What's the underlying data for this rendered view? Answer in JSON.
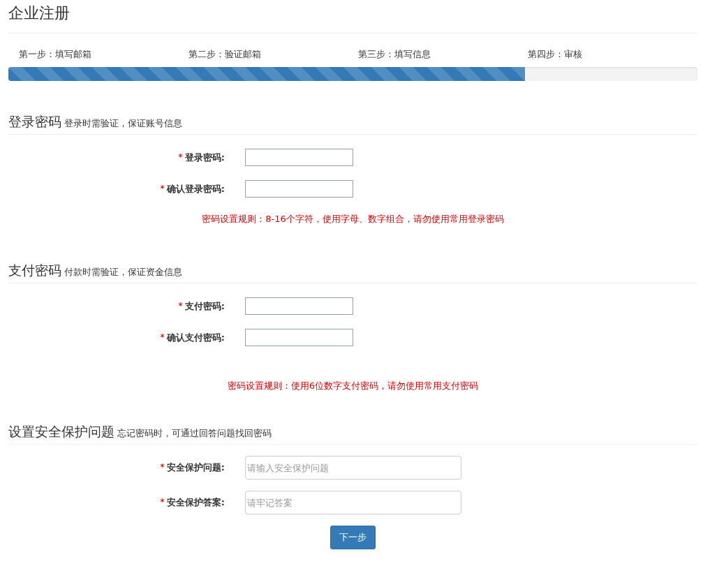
{
  "title": "企业注册",
  "steps": [
    {
      "label": "第一步：填写邮箱"
    },
    {
      "label": "第二步：验证邮箱"
    },
    {
      "label": "第三步：填写信息"
    },
    {
      "label": "第四步：审核"
    }
  ],
  "progress": {
    "level": 0.75
  },
  "sections": [
    {
      "title": "登录密码",
      "subtitle": "登录时需验证，保证账号信息",
      "fields": [
        {
          "kind": "password",
          "required_mark": "*",
          "label": "登录密码:"
        },
        {
          "kind": "password",
          "required_mark": "*",
          "label": "确认登录密码:"
        }
      ],
      "note": "密码设置规则：8-16个字符，使用字母、数字组合，请勿使用常用登录密码"
    },
    {
      "title": "支付密码",
      "subtitle": "付款时需验证，保证资金信息",
      "fields": [
        {
          "kind": "password",
          "required_mark": "*",
          "label": "支付密码:"
        },
        {
          "kind": "password",
          "required_mark": "*",
          "label": "确认支付密码:"
        }
      ],
      "note": "密码设置规则：使用6位数字支付密码，请勿使用常用支付密码"
    },
    {
      "title": "设置安全保护问题",
      "subtitle": "忘记密码时，可通过回答问题找回密码",
      "fields": [
        {
          "kind": "text",
          "required_mark": "*",
          "label": "安全保护问题:",
          "placeholder": "请输入安全保护问题"
        },
        {
          "kind": "text",
          "required_mark": "*",
          "label": "安全保护答案:",
          "placeholder": "请牢记答案"
        }
      ]
    }
  ],
  "button": {
    "label": "下一步"
  }
}
